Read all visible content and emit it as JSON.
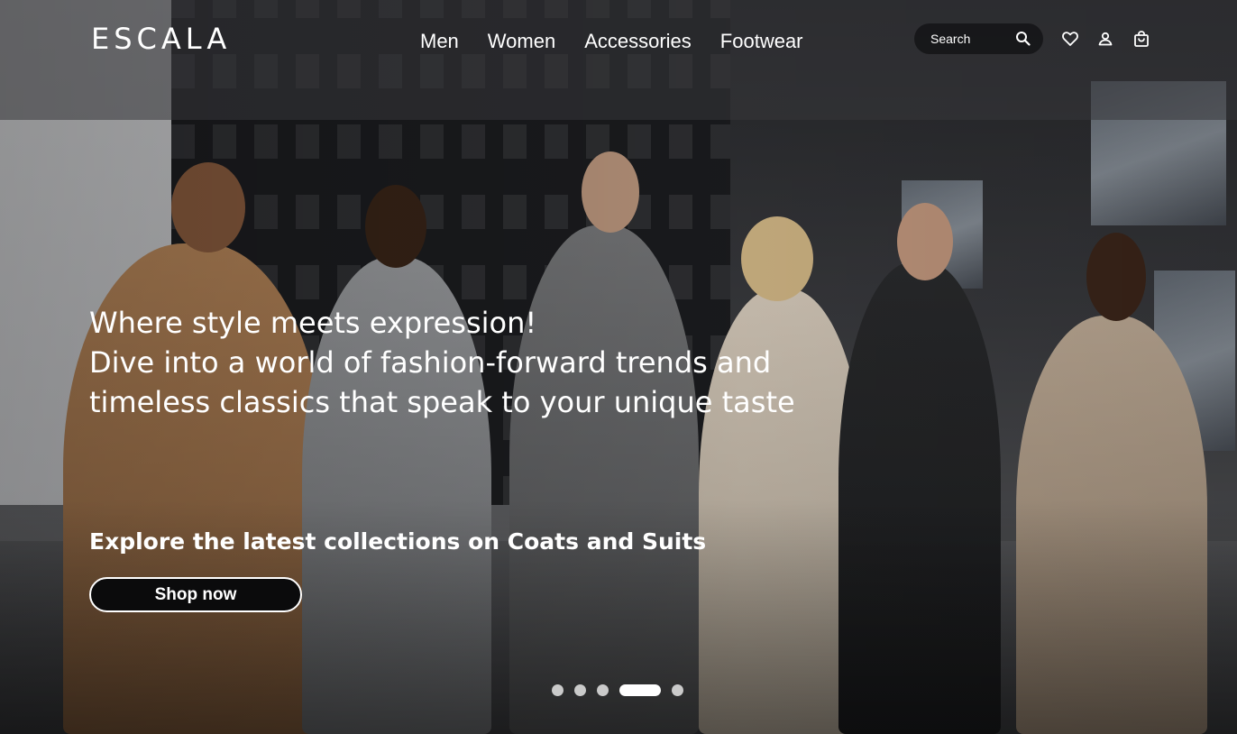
{
  "brand": {
    "logo_text": "ESCALA"
  },
  "nav": {
    "items": [
      {
        "label": "Men"
      },
      {
        "label": "Women"
      },
      {
        "label": "Accessories"
      },
      {
        "label": "Footwear"
      }
    ]
  },
  "search": {
    "placeholder": "Search",
    "icon": "search-icon"
  },
  "header_icons": [
    {
      "name": "heart-icon"
    },
    {
      "name": "user-icon"
    },
    {
      "name": "shopping-bag-icon"
    }
  ],
  "hero": {
    "tagline_lines": [
      "Where style meets expression!",
      "Dive into a world of fashion-forward trends and",
      "timeless classics that speak to your unique taste"
    ],
    "promo": "Explore the latest collections on Coats and Suits",
    "cta_label": "Shop now",
    "carousel": {
      "total_slides": 5,
      "active_slide": 4
    }
  },
  "colors": {
    "text": "#ffffff",
    "button_bg": "#0b0b0c",
    "header_overlay": "#37373a"
  }
}
